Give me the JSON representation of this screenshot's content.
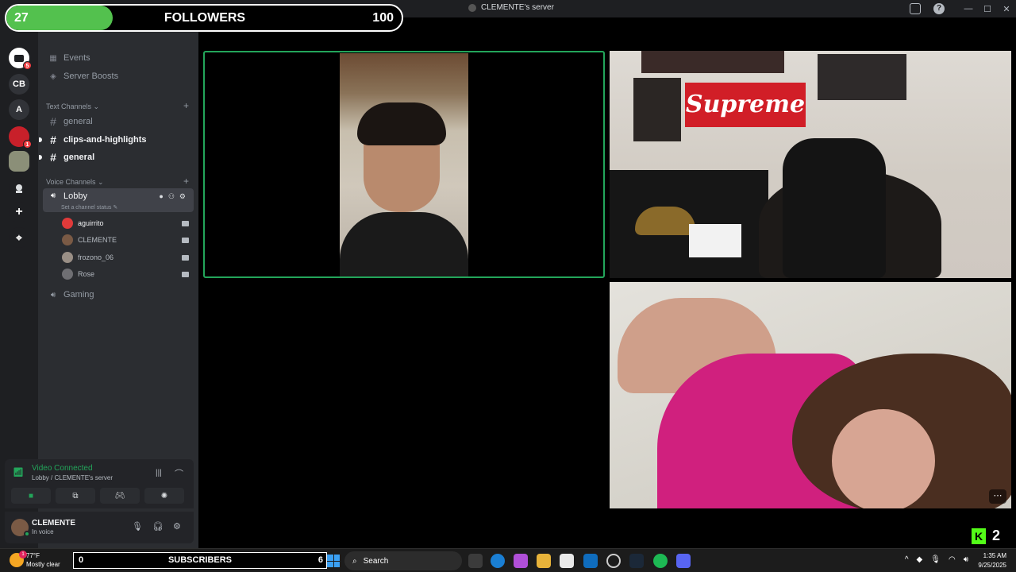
{
  "window": {
    "title": "CLEMENTE's server"
  },
  "overlay": {
    "followers": {
      "current": "27",
      "label": "FOLLOWERS",
      "goal": "100",
      "progress_fraction": 0.27
    },
    "subscribers": {
      "current": "0",
      "label": "SUBSCRIBERS",
      "goal": "6"
    },
    "kick": {
      "viewers": "2",
      "logo_letter": "K"
    }
  },
  "rail": {
    "servers": [
      {
        "label": "",
        "badge": "5"
      },
      {
        "label": "CB"
      },
      {
        "label": "A"
      },
      {
        "label": "",
        "badge": "1"
      },
      {
        "label": ""
      },
      {
        "label": ""
      }
    ],
    "add_label": "+",
    "discover_label": "⌖"
  },
  "sidebar": {
    "server_name": "CLEMENTE's server",
    "items": [
      {
        "label": "Events"
      },
      {
        "label": "Server Boosts"
      }
    ],
    "text_category": "Text Channels",
    "text_channels": [
      {
        "label": "general",
        "unread": false
      },
      {
        "label": "clips-and-highlights",
        "unread": true
      },
      {
        "label": "general",
        "unread": true
      }
    ],
    "voice_category": "Voice Channels",
    "lobby": {
      "label": "Lobby",
      "status_hint": "Set a channel status"
    },
    "voice_users": [
      {
        "name": "aguirrito",
        "avatar_color": "#e03a3a"
      },
      {
        "name": "CLEMENTE",
        "avatar_color": "#7a5a45"
      },
      {
        "name": "frozono_06",
        "avatar_color": "#9a8f86"
      },
      {
        "name": "Rose",
        "avatar_color": "#6f6f73"
      }
    ],
    "gaming": {
      "label": "Gaming"
    }
  },
  "voice_panel": {
    "title": "Video Connected",
    "subtitle": "Lobby / CLEMENTE's server"
  },
  "user_panel": {
    "name": "CLEMENTE",
    "status": "In voice"
  },
  "stage": {
    "poster_text": "Supreme",
    "more_label": "⋯"
  },
  "taskbar": {
    "weather_temp": "77°F",
    "weather_desc": "Mostly clear",
    "weather_badge": "1",
    "search_label": "Search",
    "time": "1:35 AM",
    "date": "9/25/2025"
  },
  "colors": {
    "accent_green": "#23a55a",
    "follower_fill": "#53c14e",
    "kick_green": "#53fc18"
  }
}
